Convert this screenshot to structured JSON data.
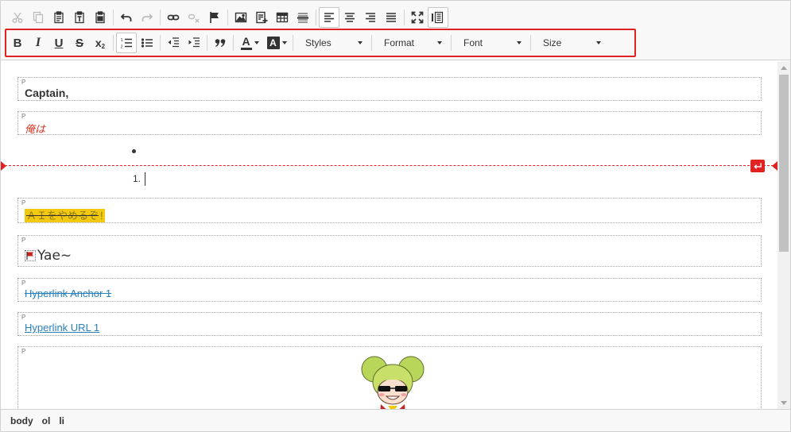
{
  "toolbar": {
    "row1": [
      {
        "name": "cut-button",
        "icon": "scissors-icon",
        "disabled": true
      },
      {
        "name": "copy-button",
        "icon": "copy-icon",
        "disabled": true
      },
      {
        "name": "paste-button",
        "icon": "clipboard-icon"
      },
      {
        "name": "paste-text-button",
        "icon": "clipboard-text-icon"
      },
      {
        "name": "paste-word-button",
        "icon": "clipboard-word-icon"
      },
      {
        "name": "undo-button",
        "icon": "undo-icon"
      },
      {
        "name": "redo-button",
        "icon": "redo-icon",
        "disabled": true
      },
      {
        "name": "link-button",
        "icon": "link-icon"
      },
      {
        "name": "unlink-button",
        "icon": "unlink-icon",
        "disabled": true
      },
      {
        "name": "anchor-button",
        "icon": "flag-icon"
      },
      {
        "name": "image-button",
        "icon": "image-icon"
      },
      {
        "name": "insert-element-button",
        "icon": "insert-doc-icon"
      },
      {
        "name": "table-button",
        "icon": "table-icon"
      },
      {
        "name": "horizontal-rule-button",
        "icon": "horizontal-rule-icon"
      },
      {
        "name": "align-left-button",
        "icon": "align-left-icon",
        "pressed": true
      },
      {
        "name": "align-center-button",
        "icon": "align-center-icon"
      },
      {
        "name": "align-right-button",
        "icon": "align-right-icon"
      },
      {
        "name": "align-justify-button",
        "icon": "align-justify-icon"
      },
      {
        "name": "maximize-button",
        "icon": "maximize-icon"
      },
      {
        "name": "show-blocks-button",
        "icon": "show-blocks-icon",
        "pressed": true
      }
    ],
    "row2": {
      "bold": "B",
      "italic": "I",
      "underline": "U",
      "strike": "S",
      "subscript": "x",
      "subscript_sub": "2",
      "text_color": "A",
      "bg_color": "A"
    },
    "dropdowns": {
      "styles": "Styles",
      "format": "Format",
      "font": "Font",
      "size": "Size"
    }
  },
  "content": {
    "p1": {
      "tag": "P",
      "text": "Captain,"
    },
    "p2": {
      "tag": "P",
      "text": "俺は"
    },
    "list": {
      "number": "1."
    },
    "p3": {
      "tag": "P",
      "text": "ＡＩをやめるぞ",
      "tail": "!"
    },
    "p4": {
      "tag": "P",
      "text": "Yae~"
    },
    "p5": {
      "tag": "P",
      "text": "Hyperlink Anchor 1"
    },
    "p6": {
      "tag": "P",
      "text": "Hyperlink URL 1"
    },
    "p7": {
      "tag": "P"
    }
  },
  "statusbar": {
    "path": [
      "body",
      "ol",
      "li"
    ]
  },
  "colors": {
    "accent_red": "#e02222",
    "link_blue": "#2980b9",
    "highlight_yellow": "#f2c811",
    "red_text": "#d63a2a"
  }
}
